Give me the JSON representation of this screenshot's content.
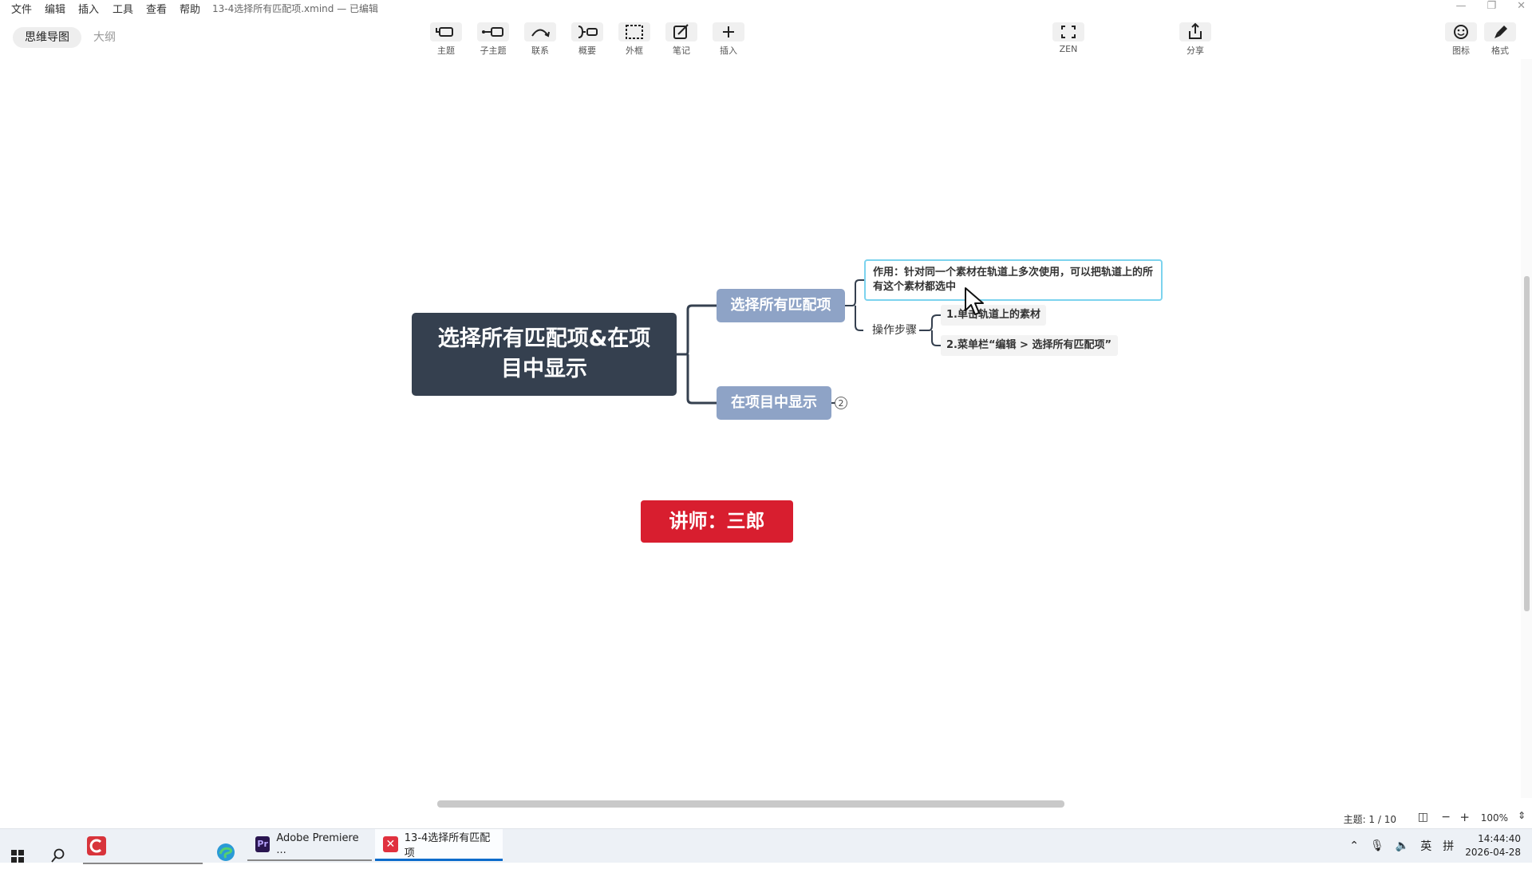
{
  "menu": {
    "items": [
      "文件",
      "编辑",
      "插入",
      "工具",
      "查看",
      "帮助"
    ],
    "document_title": "13-4选择所有匹配项.xmind — 已编辑"
  },
  "view_tabs": {
    "mindmap": "思维导图",
    "outline": "大纲"
  },
  "toolbar": {
    "topic": "主题",
    "subtopic": "子主题",
    "relationship": "联系",
    "summary": "概要",
    "boundary": "外框",
    "note": "笔记",
    "insert": "插入",
    "zen": "ZEN",
    "share": "分享",
    "icons": "图标",
    "format": "格式"
  },
  "mindmap": {
    "root": {
      "line1": "选择所有匹配项&在项",
      "line2": "目中显示"
    },
    "branch1": "选择所有匹配项",
    "note_text": "作用：针对同一个素材在轨道上多次使用，可以把轨道上的所有这个素材都选中",
    "steps_label": "操作步骤",
    "step1": "1.单击轨道上的素材",
    "step2": "2.菜单栏“编辑 > 选择所有匹配项”",
    "branch2": "在项目中显示",
    "collapsed_count": "2",
    "lecturer": "讲师：三郎"
  },
  "status": {
    "topic_count": "主题: 1 / 10",
    "zoom": "100%"
  },
  "taskbar": {
    "premiere_label": "Adobe Premiere ...",
    "xmind_label": "13-4选择所有匹配项",
    "ime_lang": "英",
    "ime_mode": "拼",
    "time": "14:44:40",
    "date": "2026-04-28"
  },
  "colors": {
    "root_fill": "#35404f",
    "branch_fill": "#8ea3c6",
    "lecturer_fill": "#d81e2f",
    "selection_border": "#7cd3ee"
  }
}
